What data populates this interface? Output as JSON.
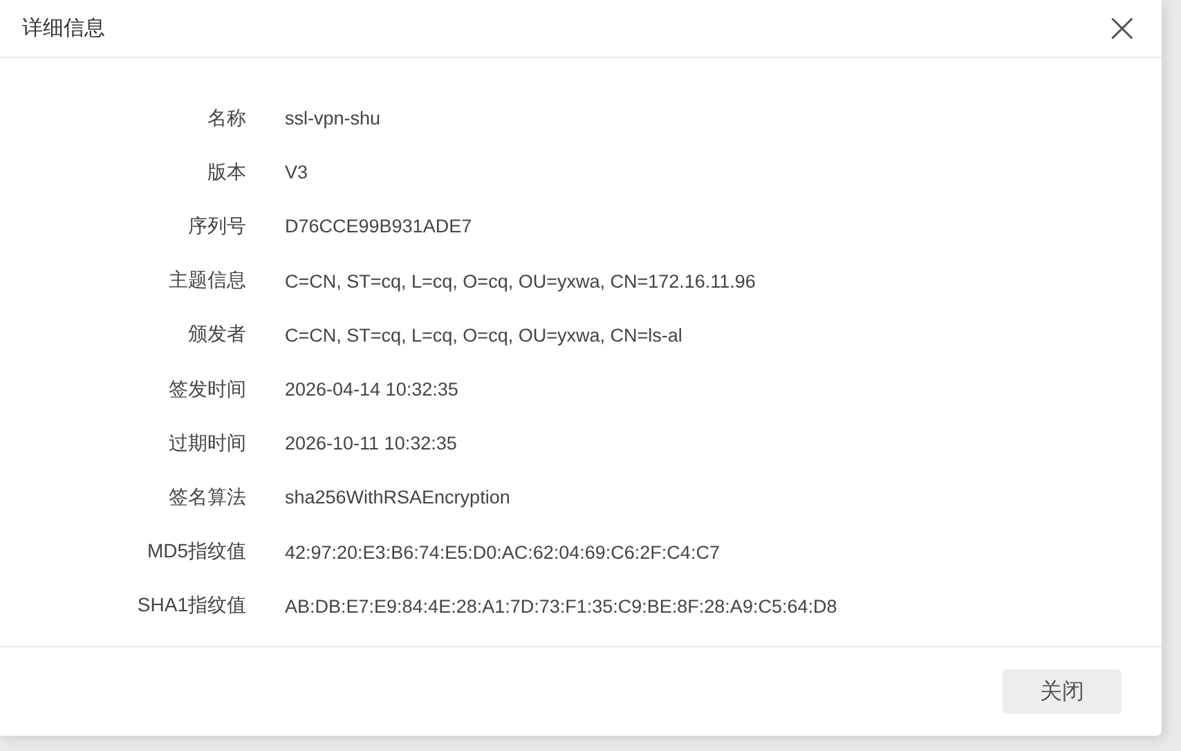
{
  "dialog": {
    "title": "详细信息",
    "close_icon": "×",
    "fields": [
      {
        "label": "名称",
        "value": "ssl-vpn-shu"
      },
      {
        "label": "版本",
        "value": "V3"
      },
      {
        "label": "序列号",
        "value": "D76CCE99B931ADE7"
      },
      {
        "label": "主题信息",
        "value": "C=CN, ST=cq, L=cq, O=cq, OU=yxwa, CN=172.16.11.96"
      },
      {
        "label": "颁发者",
        "value": "C=CN, ST=cq, L=cq, O=cq, OU=yxwa, CN=ls-al"
      },
      {
        "label": "签发时间",
        "value": "2026-04-14 10:32:35"
      },
      {
        "label": "过期时间",
        "value": "2026-10-11 10:32:35"
      },
      {
        "label": "签名算法",
        "value": "sha256WithRSAEncryption"
      },
      {
        "label": "MD5指纹值",
        "value": "42:97:20:E3:B6:74:E5:D0:AC:62:04:69:C6:2F:C4:C7"
      },
      {
        "label": "SHA1指纹值",
        "value": "AB:DB:E7:E9:84:4E:28:A1:7D:73:F1:35:C9:BE:8F:28:A9:C5:64:D8"
      }
    ],
    "buttons": [
      "关闭"
    ]
  }
}
